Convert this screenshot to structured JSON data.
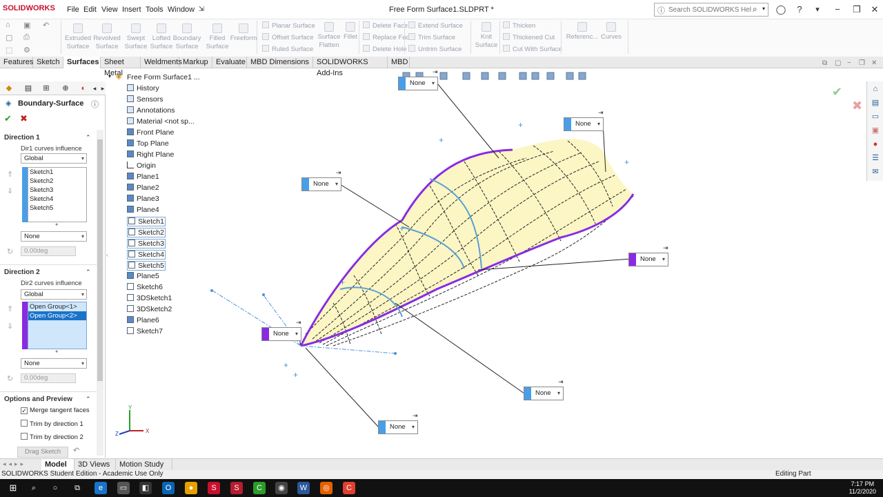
{
  "app": {
    "logo": "SOLIDWORKS",
    "menu": [
      "File",
      "Edit",
      "View",
      "Insert",
      "Tools",
      "Window"
    ],
    "document_title": "Free Form Surface1.SLDPRT *",
    "search_placeholder": "Search SOLIDWORKS Help"
  },
  "commands": {
    "large": [
      {
        "label": "Extruded Surface",
        "icon": "extruded-surface-icon"
      },
      {
        "label": "Revolved Surface",
        "icon": "revolved-surface-icon"
      },
      {
        "label": "Swept Surface",
        "icon": "swept-surface-icon"
      },
      {
        "label": "Lofted Surface",
        "icon": "lofted-surface-icon"
      },
      {
        "label": "Boundary Surface",
        "icon": "boundary-surface-icon"
      },
      {
        "label": "Filled Surface",
        "icon": "filled-surface-icon"
      },
      {
        "label": "Freeform",
        "icon": "freeform-icon"
      }
    ],
    "col1": [
      "Planar Surface",
      "Offset Surface",
      "Ruled Surface"
    ],
    "surface_flatten": "Surface Flatten",
    "fillet": "Fillet",
    "col2": [
      "Delete Face",
      "Replace Face",
      "Delete Hole"
    ],
    "col3": [
      "Extend Surface",
      "Trim Surface",
      "Untrim Surface"
    ],
    "knit": "Knit Surface",
    "col4": [
      "Thicken",
      "Thickened Cut",
      "Cut With Surface"
    ],
    "reference": "Referenc...",
    "curves": "Curves"
  },
  "tabs": [
    "Features",
    "Sketch",
    "Surfaces",
    "Sheet Metal",
    "Weldments",
    "Markup",
    "Evaluate",
    "MBD Dimensions",
    "SOLIDWORKS Add-Ins",
    "MBD"
  ],
  "active_tab": "Surfaces",
  "property_manager": {
    "title": "Boundary-Surface",
    "direction1": {
      "heading": "Direction 1",
      "influence_label": "Dir1 curves influence",
      "influence_value": "Global",
      "curves": [
        "Sketch1",
        "Sketch2",
        "Sketch3",
        "Sketch4",
        "Sketch5"
      ],
      "tangency": "None",
      "angle": "0.00deg"
    },
    "direction2": {
      "heading": "Direction 2",
      "influence_label": "Dir2 curves influence",
      "influence_value": "Global",
      "curves": [
        "Open Group<1>",
        "Open Group<2>"
      ],
      "tangency": "None",
      "angle": "0.00deg"
    },
    "options": {
      "heading": "Options and Preview",
      "merge": "Merge tangent faces",
      "trim1": "Trim by direction 1",
      "trim2": "Trim by direction 2",
      "drag_sketch": "Drag Sketch"
    },
    "colors": {
      "dir1": "#4a9ee8",
      "dir2": "#8a2be2"
    }
  },
  "tree": {
    "root": "Free Form Surface1 ...",
    "items": [
      "History",
      "Sensors",
      "Annotations",
      "Material <not sp...",
      "Front Plane",
      "Top Plane",
      "Right Plane",
      "Origin",
      "Plane1",
      "Plane2",
      "Plane3",
      "Plane4",
      "Sketch1",
      "Sketch2",
      "Sketch3",
      "Sketch4",
      "Sketch5",
      "Plane5",
      "Sketch6",
      "3DSketch1",
      "3DSketch2",
      "Plane6",
      "Sketch7"
    ]
  },
  "callouts": [
    {
      "value": "None",
      "color": "#4a9ee8"
    },
    {
      "value": "None",
      "color": "#4a9ee8"
    },
    {
      "value": "None",
      "color": "#4a9ee8"
    },
    {
      "value": "None",
      "color": "#8a2be2"
    },
    {
      "value": "None",
      "color": "#8a2be2"
    },
    {
      "value": "None",
      "color": "#4a9ee8"
    },
    {
      "value": "None",
      "color": "#4a9ee8"
    }
  ],
  "bottom_tabs": [
    "Model",
    "3D Views",
    "Motion Study 1"
  ],
  "status": {
    "left": "SOLIDWORKS Student Edition - Academic Use Only",
    "right": "Editing Part"
  },
  "clock": {
    "time": "7:17 PM",
    "date": "11/2/2020"
  },
  "triad": {
    "x": "X",
    "y": "Y",
    "z": "Z"
  }
}
